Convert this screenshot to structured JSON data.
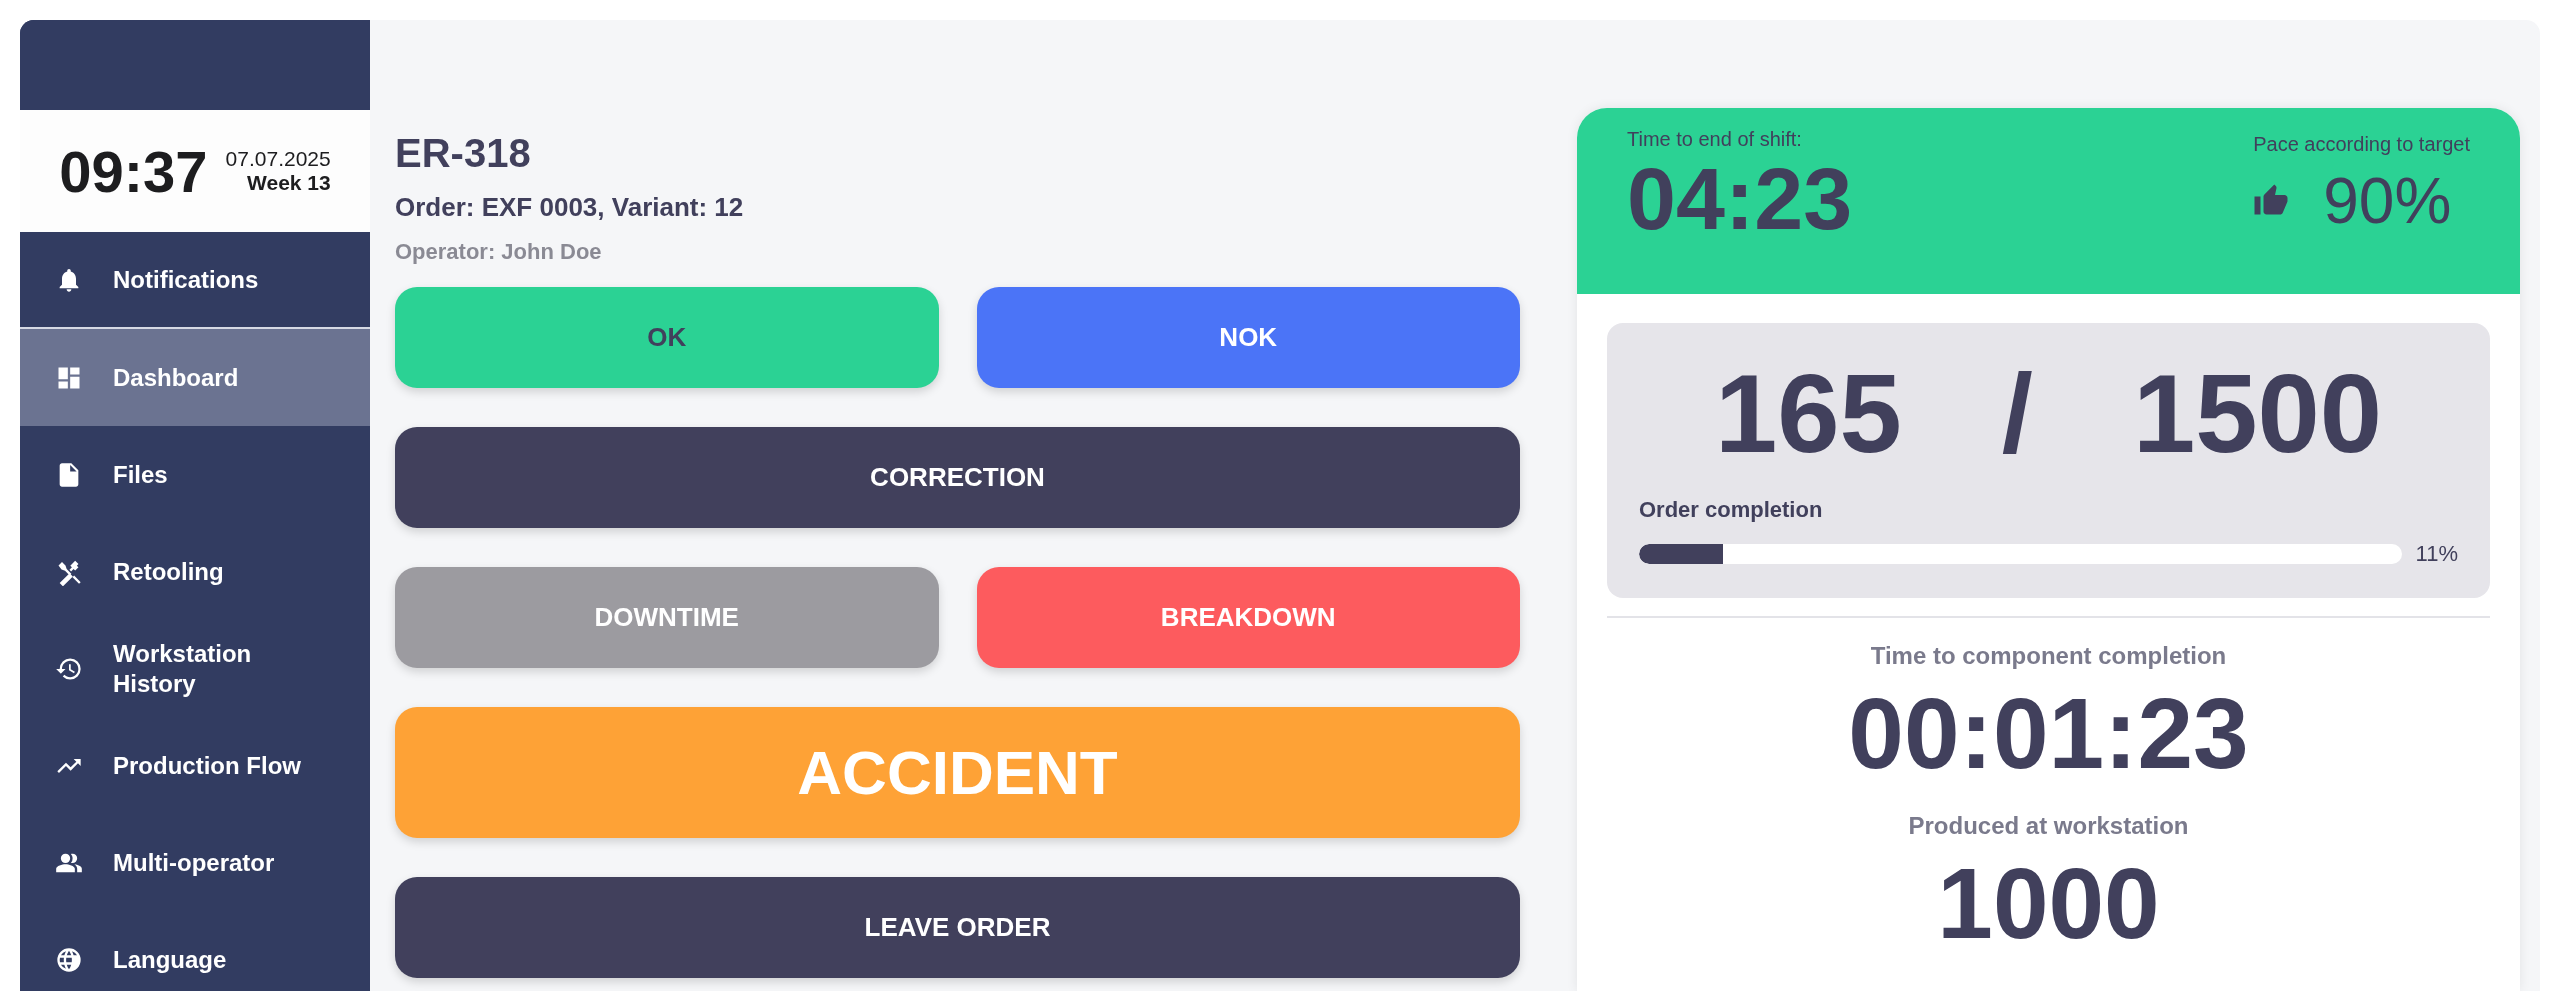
{
  "clock": {
    "time": "09:37",
    "date": "07.07.2025",
    "week": "Week 13"
  },
  "sidebar": {
    "items": [
      {
        "label": "Notifications",
        "kind": "bell",
        "selected": false
      },
      {
        "label": "Dashboard",
        "kind": "dashboard",
        "selected": true
      },
      {
        "label": "Files",
        "kind": "file",
        "selected": false
      },
      {
        "label": "Retooling",
        "kind": "tools",
        "selected": false
      },
      {
        "label": "Workstation History",
        "kind": "history",
        "selected": false
      },
      {
        "label": "Production Flow",
        "kind": "trend",
        "selected": false
      },
      {
        "label": "Multi-operator",
        "kind": "people",
        "selected": false
      },
      {
        "label": "Language",
        "kind": "globe",
        "selected": false
      }
    ]
  },
  "workstation": {
    "title": "ER-318",
    "order": "Order: EXF 0003, Variant: 12",
    "operator": "Operator: John Doe"
  },
  "actions": [
    [
      {
        "label": "OK",
        "kind": "ok"
      },
      {
        "label": "NOK",
        "kind": "nok"
      }
    ],
    [
      {
        "label": "CORRECTION",
        "kind": "dark"
      }
    ],
    [
      {
        "label": "DOWNTIME",
        "kind": "grey"
      },
      {
        "label": "BREAKDOWN",
        "kind": "red"
      }
    ],
    [
      {
        "label": "ACCIDENT",
        "kind": "accident"
      }
    ],
    [
      {
        "label": "LEAVE ORDER",
        "kind": "dark"
      }
    ]
  ],
  "shift": {
    "label": "Time to end of shift:",
    "time": "04:23",
    "pace_label": "Pace according to target",
    "pace": "90%"
  },
  "order_progress": {
    "done": "165",
    "separator": "/",
    "total": "1500",
    "label": "Order completion",
    "level": 0.11,
    "percent": "11%"
  },
  "component": {
    "label": "Time to component completion",
    "time": "00:01:23"
  },
  "produced": {
    "label": "Produced at workstation",
    "count": "1000"
  }
}
